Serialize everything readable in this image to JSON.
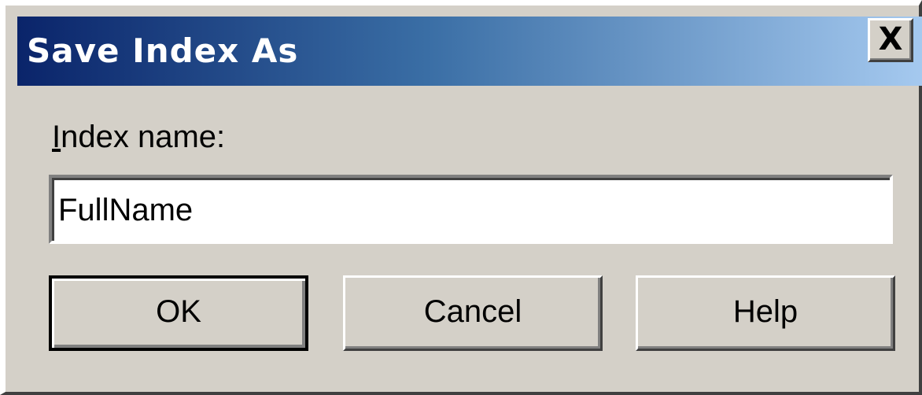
{
  "window": {
    "title": "Save Index As",
    "close_label": "X"
  },
  "form": {
    "label_access_key": "I",
    "label_rest": "ndex name:",
    "index_name_value": "FullName"
  },
  "buttons": {
    "ok_label": "OK",
    "cancel_label": "Cancel",
    "help_label": "Help"
  }
}
